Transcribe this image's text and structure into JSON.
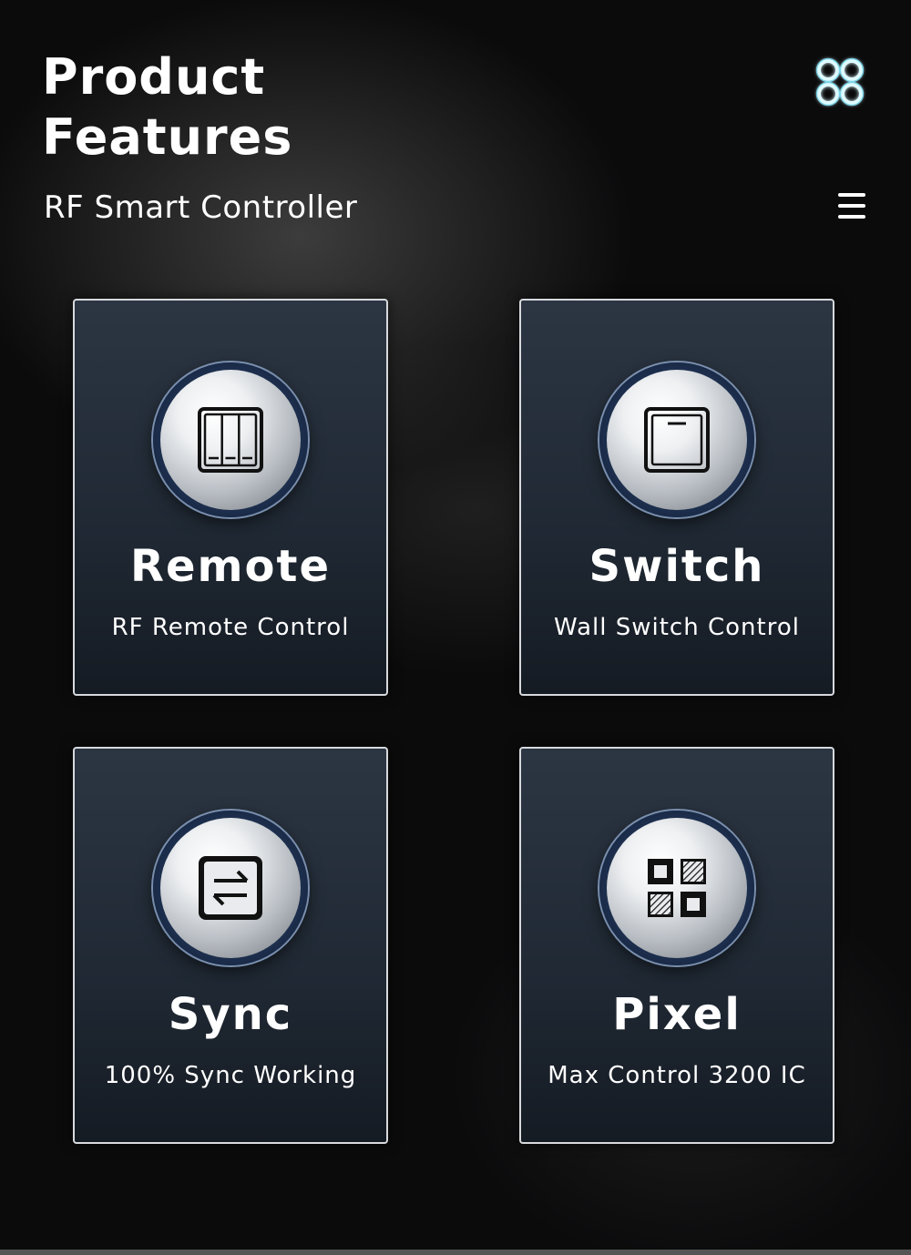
{
  "header": {
    "title_line1": "Product",
    "title_line2": "Features",
    "subtitle": "RF Smart Controller"
  },
  "icons": {
    "logo": "four-rings-logo-icon",
    "menu": "menu-icon"
  },
  "colors": {
    "background": "#0b0b0c",
    "card": "#1f2833",
    "card_border": "#d7d9dd",
    "logo_glow": "#7fe7ff",
    "text": "#ffffff"
  },
  "features": [
    {
      "title": "Remote",
      "subtitle": "RF Remote Control",
      "icon": "remote-panel-icon"
    },
    {
      "title": "Switch",
      "subtitle": "Wall Switch Control",
      "icon": "wall-switch-icon"
    },
    {
      "title": "Sync",
      "subtitle": "100% Sync Working",
      "icon": "sync-arrows-icon"
    },
    {
      "title": "Pixel",
      "subtitle": "Max Control 3200 IC",
      "icon": "pixel-grid-icon"
    }
  ]
}
